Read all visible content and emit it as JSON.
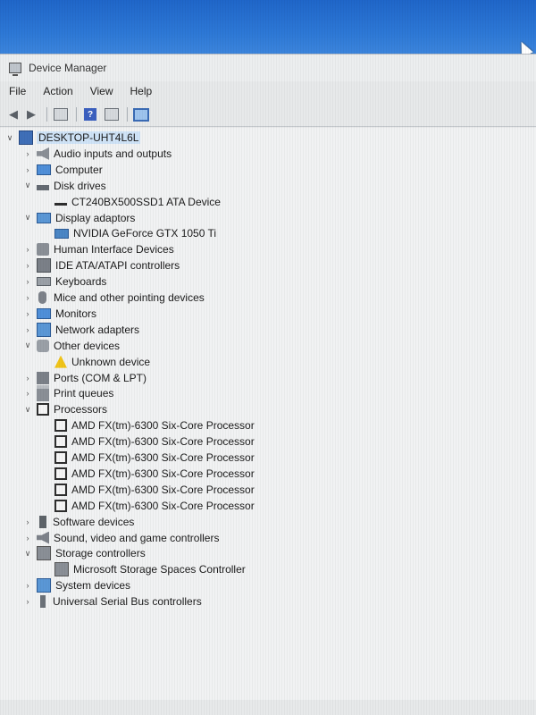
{
  "window": {
    "title": "Device Manager"
  },
  "menubar": {
    "items": [
      "File",
      "Action",
      "View",
      "Help"
    ]
  },
  "toolbar": {
    "buttons": [
      "back-arrow-icon",
      "forward-arrow-icon",
      "properties-icon",
      "help-icon",
      "update-driver-icon",
      "scan-hardware-icon"
    ]
  },
  "tree": {
    "root": "DESKTOP-UHT4L6L",
    "items": [
      {
        "label": "Audio inputs and outputs",
        "expanded": false,
        "icon": "speaker-icon"
      },
      {
        "label": "Computer",
        "expanded": false,
        "icon": "monitor-icon"
      },
      {
        "label": "Disk drives",
        "expanded": true,
        "icon": "disk-drive-icon",
        "children": [
          "CT240BX500SSD1 ATA Device"
        ]
      },
      {
        "label": "Display adaptors",
        "expanded": true,
        "icon": "display-adapter-icon",
        "children": [
          "NVIDIA GeForce GTX 1050 Ti"
        ]
      },
      {
        "label": "Human Interface Devices",
        "expanded": false,
        "icon": "hid-icon"
      },
      {
        "label": "IDE ATA/ATAPI controllers",
        "expanded": false,
        "icon": "ide-controller-icon"
      },
      {
        "label": "Keyboards",
        "expanded": false,
        "icon": "keyboard-icon"
      },
      {
        "label": "Mice and other pointing devices",
        "expanded": false,
        "icon": "mouse-icon"
      },
      {
        "label": "Monitors",
        "expanded": false,
        "icon": "monitor-icon"
      },
      {
        "label": "Network adapters",
        "expanded": false,
        "icon": "network-adapter-icon"
      },
      {
        "label": "Other devices",
        "expanded": true,
        "icon": "other-devices-icon",
        "children": [
          "Unknown device"
        ]
      },
      {
        "label": "Ports (COM & LPT)",
        "expanded": false,
        "icon": "port-icon"
      },
      {
        "label": "Print queues",
        "expanded": false,
        "icon": "printer-icon"
      },
      {
        "label": "Processors",
        "expanded": true,
        "icon": "processor-icon",
        "children": [
          "AMD FX(tm)-6300 Six-Core Processor",
          "AMD FX(tm)-6300 Six-Core Processor",
          "AMD FX(tm)-6300 Six-Core Processor",
          "AMD FX(tm)-6300 Six-Core Processor",
          "AMD FX(tm)-6300 Six-Core Processor",
          "AMD FX(tm)-6300 Six-Core Processor"
        ]
      },
      {
        "label": "Software devices",
        "expanded": false,
        "icon": "software-device-icon"
      },
      {
        "label": "Sound, video and game controllers",
        "expanded": false,
        "icon": "sound-controller-icon"
      },
      {
        "label": "Storage controllers",
        "expanded": true,
        "icon": "storage-controller-icon",
        "children": [
          "Microsoft Storage Spaces Controller"
        ]
      },
      {
        "label": "System devices",
        "expanded": false,
        "icon": "system-device-icon"
      },
      {
        "label": "Universal Serial Bus controllers",
        "expanded": false,
        "icon": "usb-icon"
      }
    ]
  }
}
